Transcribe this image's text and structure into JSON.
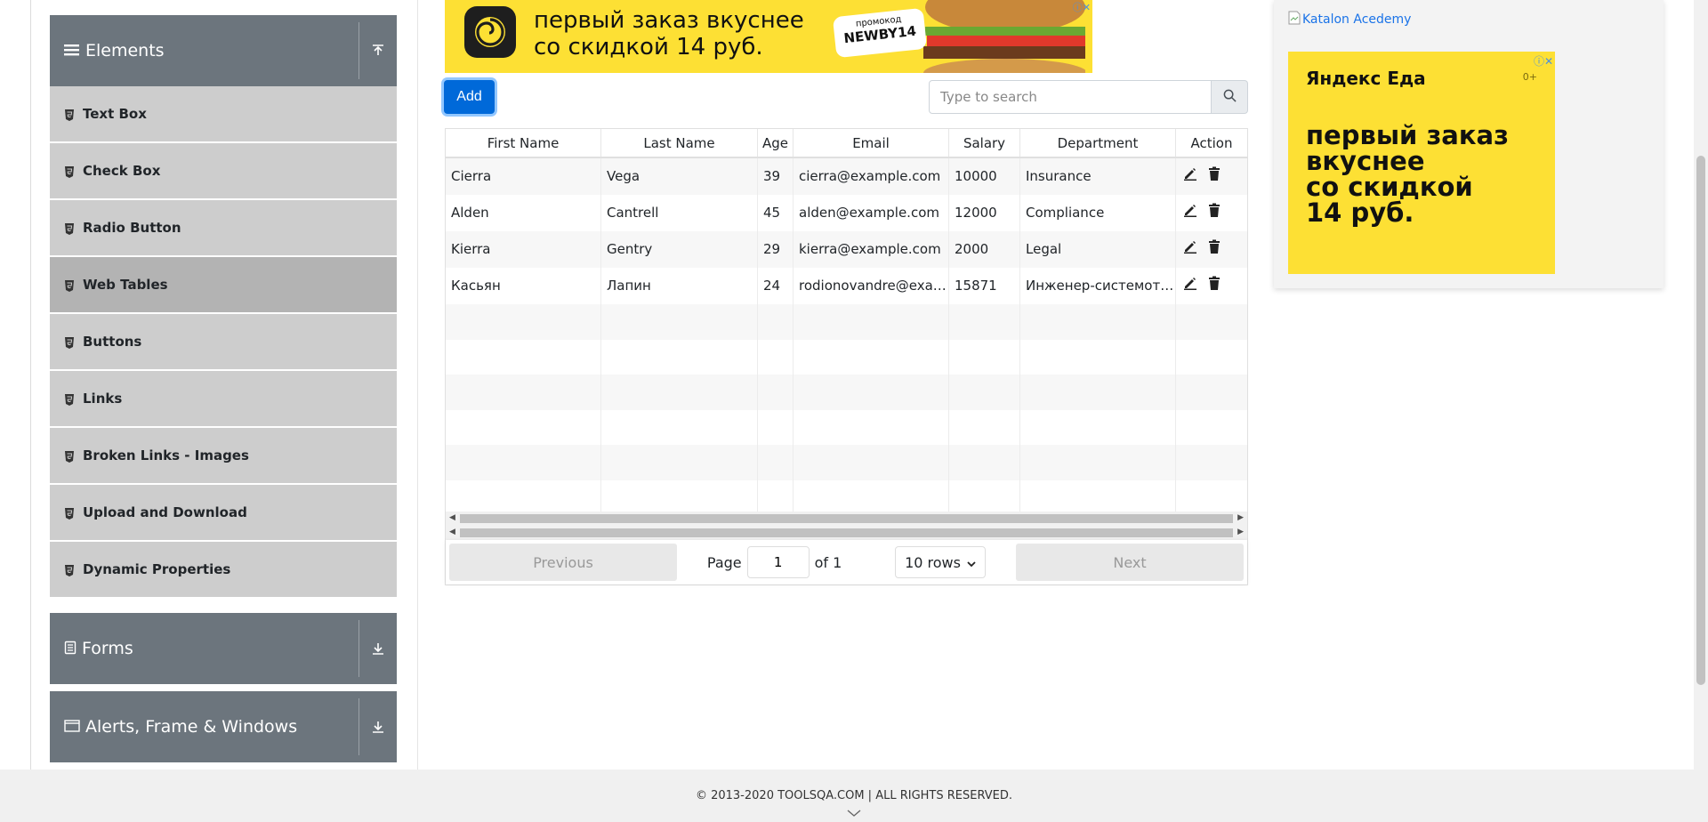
{
  "sidebar": {
    "elements_group": {
      "title": "Elements",
      "icon": "hamburger-icon",
      "toggle_icon": "collapse-up-icon"
    },
    "items": [
      {
        "label": "Text Box",
        "active": false
      },
      {
        "label": "Check Box",
        "active": false
      },
      {
        "label": "Radio Button",
        "active": false
      },
      {
        "label": "Web Tables",
        "active": true
      },
      {
        "label": "Buttons",
        "active": false
      },
      {
        "label": "Links",
        "active": false
      },
      {
        "label": "Broken Links - Images",
        "active": false
      },
      {
        "label": "Upload and Download",
        "active": false
      },
      {
        "label": "Dynamic Properties",
        "active": false
      }
    ],
    "forms_group": {
      "title": "Forms",
      "icon": "form-icon",
      "toggle_icon": "expand-down-icon"
    },
    "alerts_group": {
      "title": "Alerts, Frame & Windows",
      "icon": "window-icon",
      "toggle_icon": "expand-down-icon"
    }
  },
  "banner_ad": {
    "line1": "первый заказ вкуснее",
    "line2": "со скидкой 14 руб.",
    "promo_label": "промокод",
    "promo_code": "NEWBY14"
  },
  "toolbar": {
    "add_label": "Add",
    "search_placeholder": "Type to search",
    "search_value": ""
  },
  "table": {
    "columns": [
      "First Name",
      "Last Name",
      "Age",
      "Email",
      "Salary",
      "Department",
      "Action"
    ],
    "rows": [
      [
        "Cierra",
        "Vega",
        "39",
        "cierra@example.com",
        "10000",
        "Insurance"
      ],
      [
        "Alden",
        "Cantrell",
        "45",
        "alden@example.com",
        "12000",
        "Compliance"
      ],
      [
        "Kierra",
        "Gentry",
        "29",
        "kierra@example.com",
        "2000",
        "Legal"
      ],
      [
        "Касьян",
        "Лапин",
        "24",
        "rodionovandre@example.com",
        "15871",
        "Инженер-системотехник"
      ]
    ],
    "empty_rows": 6
  },
  "pagination": {
    "previous_label": "Previous",
    "page_label": "Page",
    "page_value": "1",
    "of_label": "of 1",
    "rows_option": "10 rows",
    "next_label": "Next"
  },
  "right_ad": {
    "broken_image_alt": "Katalon Acedemy",
    "brand": "Яндекс Еда",
    "age_rating": "0+",
    "text_line1": "первый заказ",
    "text_line2": "вкуснее",
    "text_line3": "со скидкой",
    "text_line4": "14 руб."
  },
  "footer": {
    "copyright": "© 2013-2020 TOOLSQA.COM | ALL RIGHTS RESERVED."
  },
  "colors": {
    "group_header_bg": "#6c757d",
    "menu_item_bg": "#cdcdcd",
    "menu_item_active_bg": "#b3b3b3",
    "primary": "#0069d9",
    "ad_yellow": "#fde034"
  }
}
